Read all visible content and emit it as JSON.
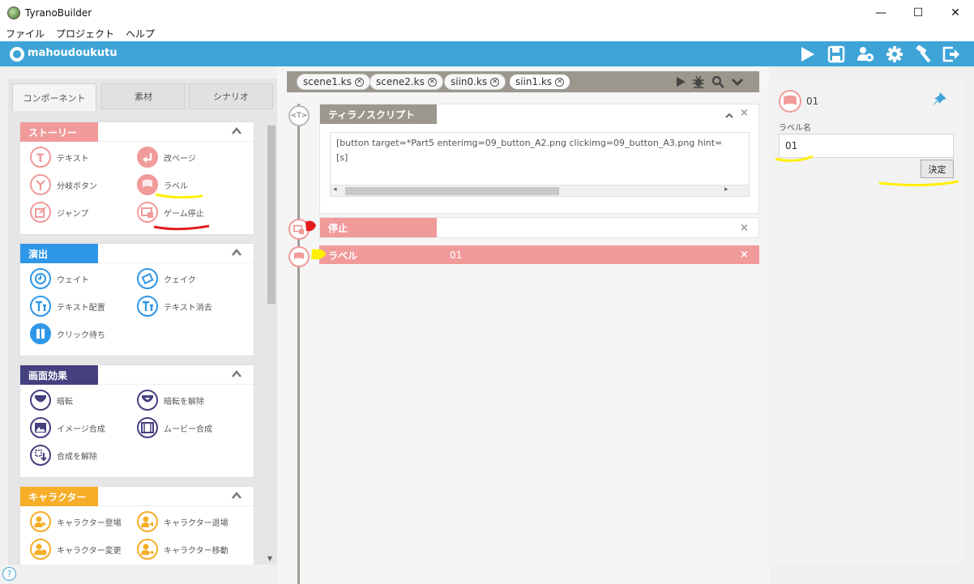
{
  "window": {
    "title": "TyranoBuilder",
    "controls": [
      "—",
      "☐",
      "✕"
    ]
  },
  "menu": [
    "ファイル",
    "プロジェクト",
    "ヘルプ"
  ],
  "header": {
    "project_name": "mahoudoukutu",
    "actions": [
      "play-icon",
      "save-icon",
      "character-settings-icon",
      "gear-icon",
      "build-icon",
      "exit-icon"
    ]
  },
  "left_tabs": [
    "コンポーネント",
    "素材",
    "シナリオ"
  ],
  "categories": [
    {
      "label": "ストーリー",
      "color": "#f19a9a",
      "items": [
        {
          "label": "テキスト",
          "icon": "text-icon"
        },
        {
          "label": "改ページ",
          "icon": "page-break-icon"
        },
        {
          "label": "分岐ボタン",
          "icon": "branch-icon"
        },
        {
          "label": "ラベル",
          "icon": "flag-icon"
        },
        {
          "label": "ジャンプ",
          "icon": "jump-icon"
        },
        {
          "label": "ゲーム停止",
          "icon": "stop-icon"
        }
      ]
    },
    {
      "label": "演出",
      "color": "#2f97e8",
      "items": [
        {
          "label": "ウェイト",
          "icon": "clock-icon"
        },
        {
          "label": "クェイク",
          "icon": "quake-icon"
        },
        {
          "label": "テキスト配置",
          "icon": "text-place-icon"
        },
        {
          "label": "テキスト消去",
          "icon": "text-clear-icon"
        },
        {
          "label": "クリック待ち",
          "icon": "pause-icon"
        }
      ]
    },
    {
      "label": "画面効果",
      "color": "#45407f",
      "items": [
        {
          "label": "暗転",
          "icon": "fade-out-icon"
        },
        {
          "label": "暗転を解除",
          "icon": "fade-in-icon"
        },
        {
          "label": "イメージ合成",
          "icon": "image-icon"
        },
        {
          "label": "ムービー合成",
          "icon": "movie-icon"
        },
        {
          "label": "合成を解除",
          "icon": "clear-composite-icon"
        }
      ]
    },
    {
      "label": "キャラクター",
      "color": "#f6ad27",
      "items": [
        {
          "label": "キャラクター登場",
          "icon": "character-enter-icon"
        },
        {
          "label": "キャラクター退場",
          "icon": "character-exit-icon"
        },
        {
          "label": "キャラクター変更",
          "icon": "character-change-icon"
        },
        {
          "label": "キャラクター移動",
          "icon": "character-move-icon"
        }
      ]
    }
  ],
  "file_tabs": [
    {
      "name": "scene1.ks",
      "active": false
    },
    {
      "name": "scene2.ks",
      "active": false
    },
    {
      "name": "siin0.ks",
      "active": false
    },
    {
      "name": "siin1.ks",
      "active": true
    }
  ],
  "editor_tools": [
    "play-icon",
    "bug-icon",
    "search-icon",
    "chevron-down-icon"
  ],
  "blocks": [
    {
      "type": "script",
      "node_icon": "<T>",
      "title": "ティラノスクリプト",
      "color": "#9c978d",
      "lines": [
        "[button target=*Part5 enterimg=09_button_A2.png clickimg=09_button_A3.png hint=",
        "[s]"
      ]
    },
    {
      "type": "stop",
      "title": "停止",
      "value": "",
      "color": "#f19a9a"
    },
    {
      "type": "label",
      "title": "ラベル",
      "value": "01",
      "color": "#f19a9a"
    }
  ],
  "properties": {
    "title": "01",
    "field_label": "ラベル名",
    "field_value": "01",
    "confirm_label": "決定"
  },
  "help_label": "?"
}
